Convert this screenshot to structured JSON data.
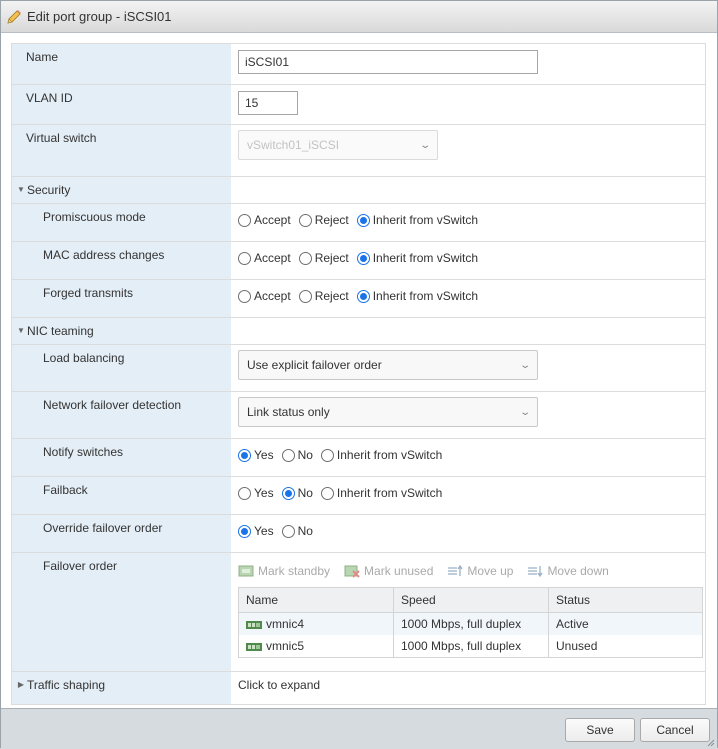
{
  "dialog": {
    "title": "Edit port group - iSCSI01",
    "title_icon": "pencil-icon"
  },
  "form": {
    "name": {
      "label": "Name",
      "value": "iSCSI01"
    },
    "vlan_id": {
      "label": "VLAN ID",
      "value": "15"
    },
    "virtual_switch": {
      "label": "Virtual switch",
      "value": "vSwitch01_iSCSI",
      "disabled": true
    },
    "security": {
      "label": "Security",
      "expanded": true,
      "promiscuous_mode": {
        "label": "Promiscuous mode",
        "options": [
          "Accept",
          "Reject",
          "Inherit from vSwitch"
        ],
        "selected": "Inherit from vSwitch"
      },
      "mac_address_changes": {
        "label": "MAC address changes",
        "options": [
          "Accept",
          "Reject",
          "Inherit from vSwitch"
        ],
        "selected": "Inherit from vSwitch"
      },
      "forged_transmits": {
        "label": "Forged transmits",
        "options": [
          "Accept",
          "Reject",
          "Inherit from vSwitch"
        ],
        "selected": "Inherit from vSwitch"
      }
    },
    "nic_teaming": {
      "label": "NIC teaming",
      "expanded": true,
      "load_balancing": {
        "label": "Load balancing",
        "value": "Use explicit failover order"
      },
      "network_failover_detection": {
        "label": "Network failover detection",
        "value": "Link status only"
      },
      "notify_switches": {
        "label": "Notify switches",
        "options": [
          "Yes",
          "No",
          "Inherit from vSwitch"
        ],
        "selected": "Yes"
      },
      "failback": {
        "label": "Failback",
        "options": [
          "Yes",
          "No",
          "Inherit from vSwitch"
        ],
        "selected": "No"
      },
      "override_failover_order": {
        "label": "Override failover order",
        "options": [
          "Yes",
          "No"
        ],
        "selected": "Yes"
      },
      "failover_order": {
        "label": "Failover order",
        "toolbar": {
          "mark_standby": "Mark standby",
          "mark_unused": "Mark unused",
          "move_up": "Move up",
          "move_down": "Move down"
        },
        "columns": [
          "Name",
          "Speed",
          "Status"
        ],
        "rows": [
          {
            "name": "vmnic4",
            "speed": "1000 Mbps, full duplex",
            "status": "Active"
          },
          {
            "name": "vmnic5",
            "speed": "1000 Mbps, full duplex",
            "status": "Unused"
          }
        ]
      }
    },
    "traffic_shaping": {
      "label": "Traffic shaping",
      "value": "Click to expand",
      "expanded": false
    }
  },
  "footer": {
    "save_label": "Save",
    "cancel_label": "Cancel"
  },
  "colors": {
    "label_bg": "#e4eef6",
    "radio_selected": "#1a73e8",
    "footer_bg": "#d6dbe0"
  }
}
